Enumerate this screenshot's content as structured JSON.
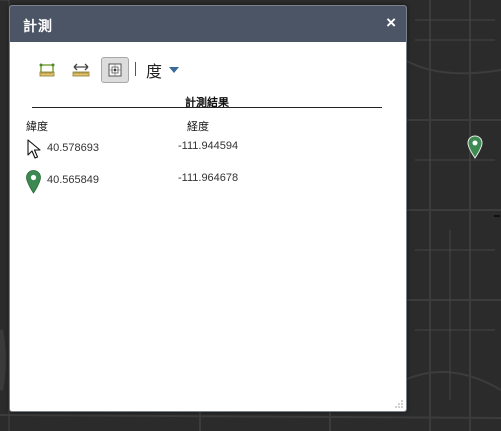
{
  "window": {
    "title": "計測",
    "close_label": "×"
  },
  "toolbar": {
    "tools": [
      {
        "icon": "area-measure-icon",
        "selected": false
      },
      {
        "icon": "distance-measure-icon",
        "selected": false
      },
      {
        "icon": "location-measure-icon",
        "selected": true
      }
    ],
    "unit": "度"
  },
  "results": {
    "title": "計測結果",
    "col_lat": "緯度",
    "col_lon": "経度",
    "rows": [
      {
        "icon": "cursor-icon",
        "lat": "40.578693",
        "lon": "-111.944594"
      },
      {
        "icon": "location-pin-icon",
        "lat": "40.565849",
        "lon": "-111.964678"
      }
    ]
  },
  "colors": {
    "titlebar": "#4c5566",
    "pin": "#3c8a52",
    "map": "#2b2b2b"
  }
}
